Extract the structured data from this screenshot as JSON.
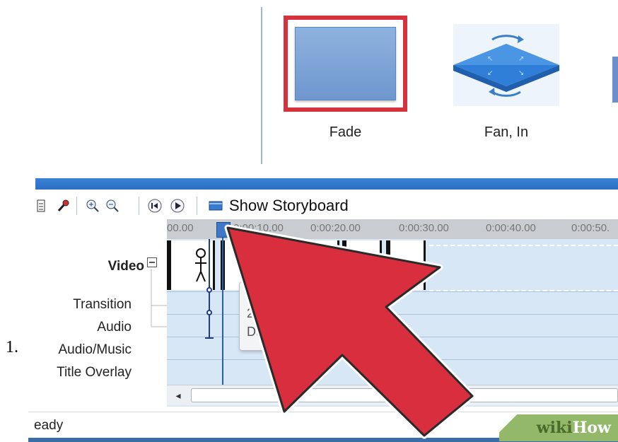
{
  "transitions": [
    {
      "label": "Fade",
      "selected": true
    },
    {
      "label": "Fan, In",
      "selected": false
    }
  ],
  "toolbar": {
    "show_storyboard_label": "Show Storyboard",
    "icons": [
      "storyboard-grid-icon",
      "narrate-microphone-icon",
      "zoom-in-icon",
      "zoom-out-icon",
      "rewind-icon",
      "play-icon",
      "storyboard-icon"
    ]
  },
  "timeline": {
    "ruler_ticks": [
      "00.00",
      "0:00:10.00",
      "0:00:20.00",
      "0:00:30.00",
      "0:00:40.00",
      "0:00:50."
    ],
    "tracks": {
      "video": "Video",
      "transition": "Transition",
      "audio": "Audio",
      "audio_music": "Audio/Music",
      "title_overlay": "Title Overlay"
    },
    "tooltip_lines": [
      "0:",
      "2",
      "Durat"
    ]
  },
  "status": {
    "text": "eady"
  },
  "list_number": "1.",
  "watermark": {
    "wiki": "wiki",
    "how": "How"
  },
  "colors": {
    "selection_border": "#d6323d",
    "arrow_red": "#d92e3e",
    "timeline_blue": "#d7e7f6",
    "accent_bar": "#2a6fc2"
  }
}
